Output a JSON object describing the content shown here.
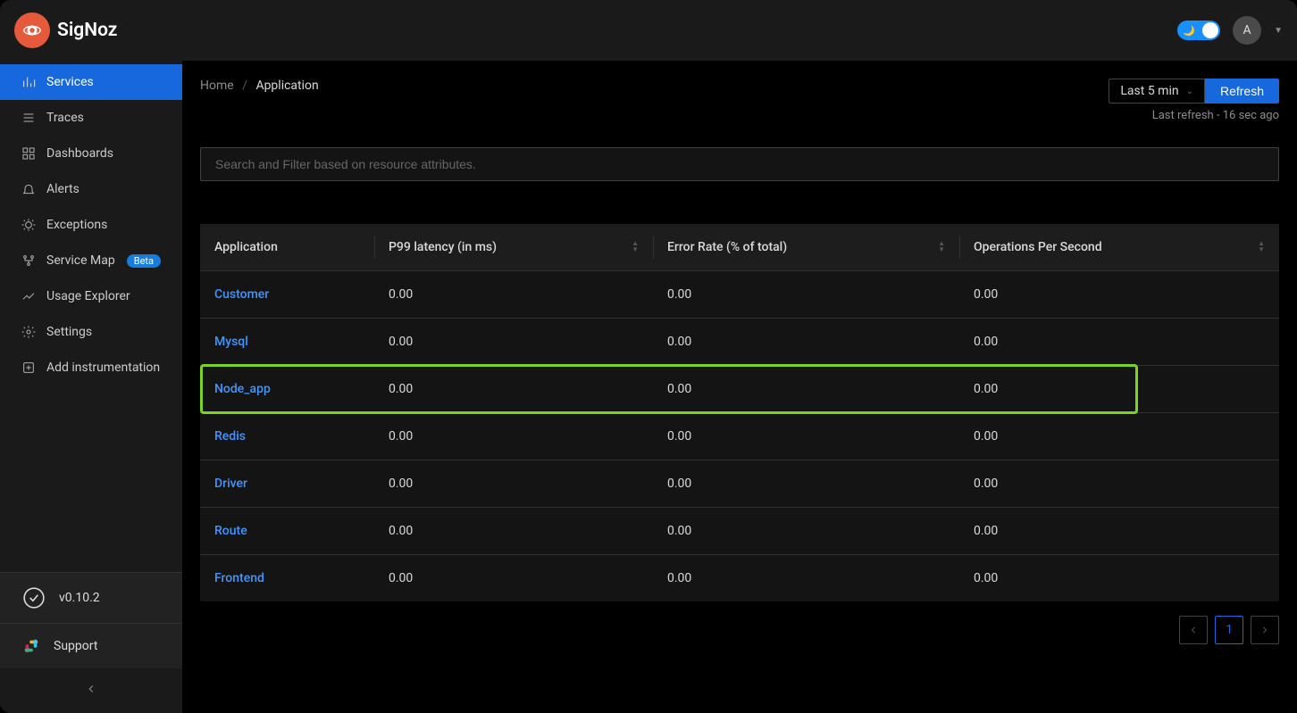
{
  "brand": "SigNoz",
  "header": {
    "avatar_initial": "A"
  },
  "sidebar": {
    "items": [
      {
        "label": "Services",
        "icon": "bar-chart-icon",
        "active": true
      },
      {
        "label": "Traces",
        "icon": "menu-icon"
      },
      {
        "label": "Dashboards",
        "icon": "dashboard-icon"
      },
      {
        "label": "Alerts",
        "icon": "bell-icon"
      },
      {
        "label": "Exceptions",
        "icon": "bug-icon"
      },
      {
        "label": "Service Map",
        "icon": "deployment-icon",
        "badge": "Beta"
      },
      {
        "label": "Usage Explorer",
        "icon": "line-chart-icon"
      },
      {
        "label": "Settings",
        "icon": "gear-icon"
      },
      {
        "label": "Add instrumentation",
        "icon": "api-icon"
      }
    ],
    "version": "v0.10.2",
    "support": "Support"
  },
  "breadcrumb": {
    "home": "Home",
    "current": "Application"
  },
  "controls": {
    "time_range": "Last 5 min",
    "refresh": "Refresh",
    "last_refresh": "Last refresh - 16 sec ago"
  },
  "search": {
    "placeholder": "Search and Filter based on resource attributes."
  },
  "table": {
    "columns": [
      "Application",
      "P99 latency (in ms)",
      "Error Rate (% of total)",
      "Operations Per Second"
    ],
    "rows": [
      {
        "app": "Customer",
        "p99": "0.00",
        "err": "0.00",
        "ops": "0.00"
      },
      {
        "app": "Mysql",
        "p99": "0.00",
        "err": "0.00",
        "ops": "0.00"
      },
      {
        "app": "Node_app",
        "p99": "0.00",
        "err": "0.00",
        "ops": "0.00",
        "highlighted": true
      },
      {
        "app": "Redis",
        "p99": "0.00",
        "err": "0.00",
        "ops": "0.00"
      },
      {
        "app": "Driver",
        "p99": "0.00",
        "err": "0.00",
        "ops": "0.00"
      },
      {
        "app": "Route",
        "p99": "0.00",
        "err": "0.00",
        "ops": "0.00"
      },
      {
        "app": "Frontend",
        "p99": "0.00",
        "err": "0.00",
        "ops": "0.00"
      }
    ]
  },
  "pagination": {
    "current": "1"
  }
}
